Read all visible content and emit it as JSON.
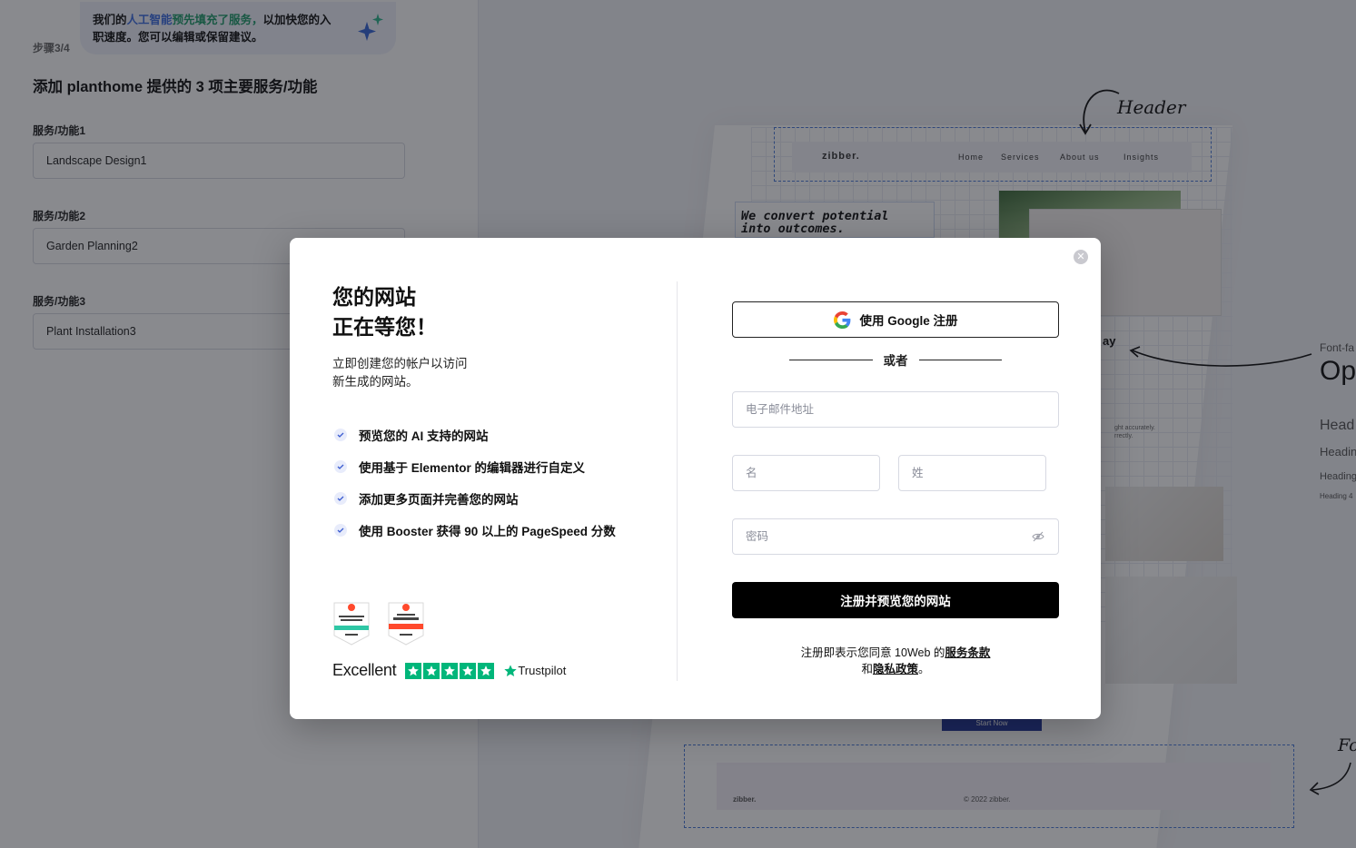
{
  "bg": {
    "ai_hint": {
      "pre": "我们的",
      "highlight1": "人工智能",
      "highlight2": "预先填充了服务，",
      "post": "以加快您的入职速度。您可以编辑或保留建议。"
    },
    "step": "步骤3/4",
    "title": "添加 planthome 提供的 3 项主要服务/功能",
    "fields": [
      {
        "label": "服务/功能1",
        "value": "Landscape Design1"
      },
      {
        "label": "服务/功能2",
        "value": "Garden Planning2"
      },
      {
        "label": "服务/功能3",
        "value": "Plant Installation3"
      }
    ]
  },
  "preview": {
    "logo": "zibber.",
    "nav": [
      "Home",
      "Services",
      "About us",
      "Insights"
    ],
    "hero_text_1": "We convert potential",
    "hero_text_2": "into outcomes.",
    "hero_tail": "ay",
    "small_text_1": "ght accurately.",
    "small_text_2": "rrectly.",
    "start_btn": "Start Now",
    "footer_logo": "zibber.",
    "footer_copy": "© 2022 zibber.",
    "annot_header": "Header",
    "annot_footer": "Fo",
    "font_label": "Font-fa",
    "font_sample": "Op",
    "headings": [
      "Head",
      "Headin",
      "Heading",
      "Heading 4"
    ]
  },
  "modal": {
    "title_line1": "您的网站",
    "title_line2": "正在等您！",
    "subtitle_line1": "立即创建您的帐户以访问",
    "subtitle_line2": "新生成的网站。",
    "features": [
      "预览您的 AI 支持的网站",
      "使用基于 Elementor 的编辑器进行自定义",
      "添加更多页面并完善您的网站",
      "使用 Booster 获得 90 以上的 PageSpeed 分数"
    ],
    "trust_excellent": "Excellent",
    "trust_brand": "Trustpilot",
    "google_btn": "使用 Google 注册",
    "or": "或者",
    "email_placeholder": "电子邮件地址",
    "first_name_placeholder": "名",
    "last_name_placeholder": "姓",
    "password_placeholder": "密码",
    "submit": "注册并预览您的网站",
    "terms_pre": "注册即表示您同意 10Web 的",
    "terms_link": "服务条款",
    "terms_and": "和",
    "privacy_link": "隐私政策",
    "terms_end": "。",
    "colors": {
      "primary": "#000000",
      "check_bg": "#e8ecfb",
      "trust_green": "#00b67a",
      "g2_red": "#ff492c"
    }
  }
}
